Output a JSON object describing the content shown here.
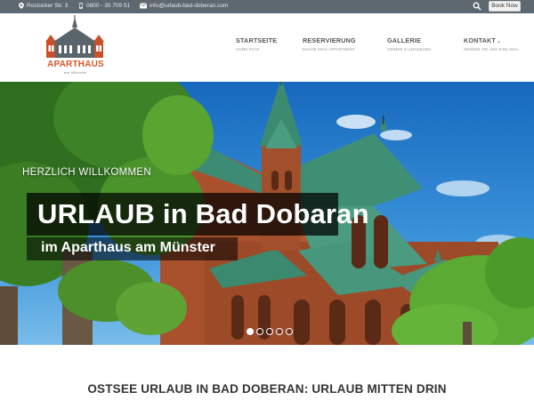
{
  "topbar": {
    "address": "Rostocker Str. 3",
    "phone": "0800 - 35 709 51",
    "email": "info@urlaub-bad-doberan.com",
    "book_now": "Book Now"
  },
  "logo": {
    "title": "APARTHAUS",
    "subtitle": "am Münster"
  },
  "nav": [
    {
      "label": "STARTSEITE",
      "sub": "HOME PAGE"
    },
    {
      "label": "RESERVIERUNG",
      "sub": "BUCHE DEIN APPARTMENT"
    },
    {
      "label": "GALLERIE",
      "sub": "ZIMMER & UMGEBUNG"
    },
    {
      "label": "KONTAKT",
      "sub": "SENDEN SIE UNS EINE MAIL"
    }
  ],
  "hero": {
    "kicker": "HERZLICH WILLKOMMEN",
    "title": "URLAUB in Bad Dobaran",
    "subtitle": "im Aparthaus am Münster",
    "slide_count": 5,
    "active_slide": 1
  },
  "section": {
    "title": "OSTSEE URLAUB IN BAD DOBERAN: URLAUB MITTEN DRIN"
  },
  "colors": {
    "topbar": "#5d6870",
    "accent": "#d8572a",
    "brick": "#b2532c",
    "copper_roof": "#3f8f74"
  }
}
